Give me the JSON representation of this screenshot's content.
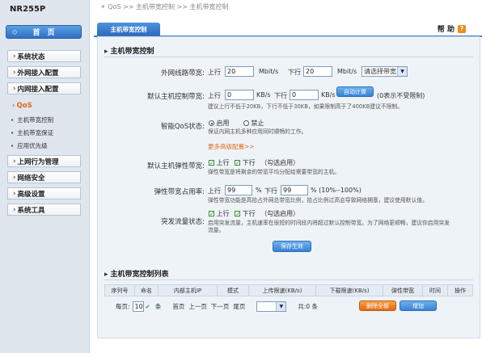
{
  "sidebar": {
    "model": "NR255P",
    "home": "首　页",
    "menus": [
      {
        "label": "系统状态"
      },
      {
        "label": "外网接入配置"
      },
      {
        "label": "内网接入配置"
      },
      {
        "label": "QoS"
      },
      {
        "label": "上网行为管理"
      },
      {
        "label": "网络安全"
      },
      {
        "label": "高级设置"
      },
      {
        "label": "系统工具"
      }
    ],
    "submenus": [
      {
        "label": "主机带宽控制"
      },
      {
        "label": "主机带宽保证"
      },
      {
        "label": "应用优先级"
      }
    ]
  },
  "breadcrumb": "QoS >> 主机带宽控制 >> 主机带宽控制",
  "tab": "主机带宽控制",
  "help": "帮 助",
  "form": {
    "section_title": "主机带宽控制",
    "wan": {
      "label": "外网线路带宽:",
      "up": "上行",
      "up_value": "20",
      "unit": "Mbit/s",
      "down": "下行",
      "down_value": "20",
      "select": "请选择带宽"
    },
    "default_bw": {
      "label": "默认主机控制带宽:",
      "up": "上行",
      "up_value": "0",
      "unit1": "KB/s",
      "down": "下行",
      "down_value": "0",
      "unit2": "KB/s",
      "auto_btn": "自动计算",
      "hint": "(0表示不受限制)",
      "note": "建议上行不低于20KB，下行不低于30KB，如果限制高于了400KB建议不限制。"
    },
    "smart_qos": {
      "label": "智能QoS状态:",
      "on": "启用",
      "off": "禁止",
      "note": "保证内网主机多种应用同时顺畅的工作。"
    },
    "more": "更多高级配置>>",
    "elastic": {
      "label": "默认主机弹性带宽:",
      "up": "上行",
      "down": "下行",
      "hint": "（勾选启用）",
      "note": "弹性带宽是将剩余的带宽平均分配给需要带宽的主机。"
    },
    "occupy": {
      "label": "弹性带宽占用率:",
      "up": "上行",
      "up_value": "99",
      "pct": "%",
      "down": "下行",
      "down_value": "99",
      "range": "% (10%--100%)",
      "note": "弹性带宽功能是高拾占外网总带宽比例，拾占比例过高会导致网络拥塞，建议使用默认值。"
    },
    "burst": {
      "label": "突发流量状态:",
      "up": "上行",
      "down": "下行",
      "hint": "（勾选启用）",
      "note1": "启用突发流量，主机速率在很短的时间段内将超过默认控制带宽。为了网络更顺畅，建议你启用突发",
      "note2": "流量。"
    },
    "save_btn": "保存生效"
  },
  "list": {
    "section_title": "主机带宽控制列表",
    "columns": [
      "序列号",
      "命名",
      "内部主机IP",
      "模式",
      "上传限速(KB/s)",
      "下载限速(KB/s)",
      "弹性带宽",
      "时间",
      "操作"
    ],
    "per_page_label": "每页:",
    "per_page_value": "10",
    "per_page_unit": "条",
    "first": "首页",
    "prev": "上一页",
    "next": "下一页",
    "last": "尾页",
    "total": "共:0 条",
    "delete_all": "删除全部",
    "add": "增加"
  }
}
